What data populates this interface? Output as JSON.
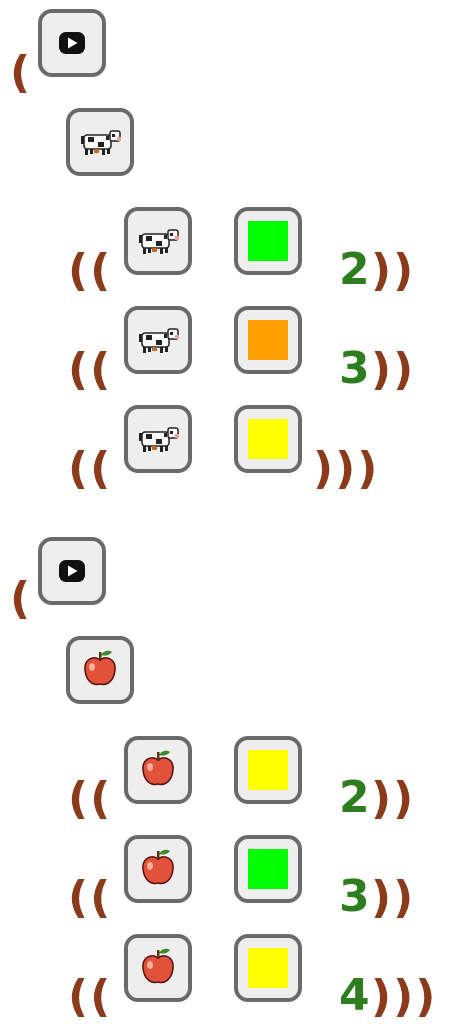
{
  "program": {
    "brackets": {
      "open_outer": "(",
      "open_pair": "((",
      "close_pair": "))",
      "close_triple": ")))"
    },
    "block1": {
      "action_icon": "play-icon",
      "subject_icon": "cow-icon",
      "rows": [
        {
          "icon": "cow-icon",
          "color": "#00ff00",
          "number": "2"
        },
        {
          "icon": "cow-icon",
          "color": "#ff9f00",
          "number": "3"
        },
        {
          "icon": "cow-icon",
          "color": "#ffff00",
          "number": ""
        }
      ]
    },
    "block2": {
      "action_icon": "play-icon",
      "subject_icon": "apple-icon",
      "rows": [
        {
          "icon": "apple-icon",
          "color": "#ffff00",
          "number": "2"
        },
        {
          "icon": "apple-icon",
          "color": "#00ff00",
          "number": "3"
        },
        {
          "icon": "apple-icon",
          "color": "#ffff00",
          "number": "4"
        }
      ]
    }
  }
}
